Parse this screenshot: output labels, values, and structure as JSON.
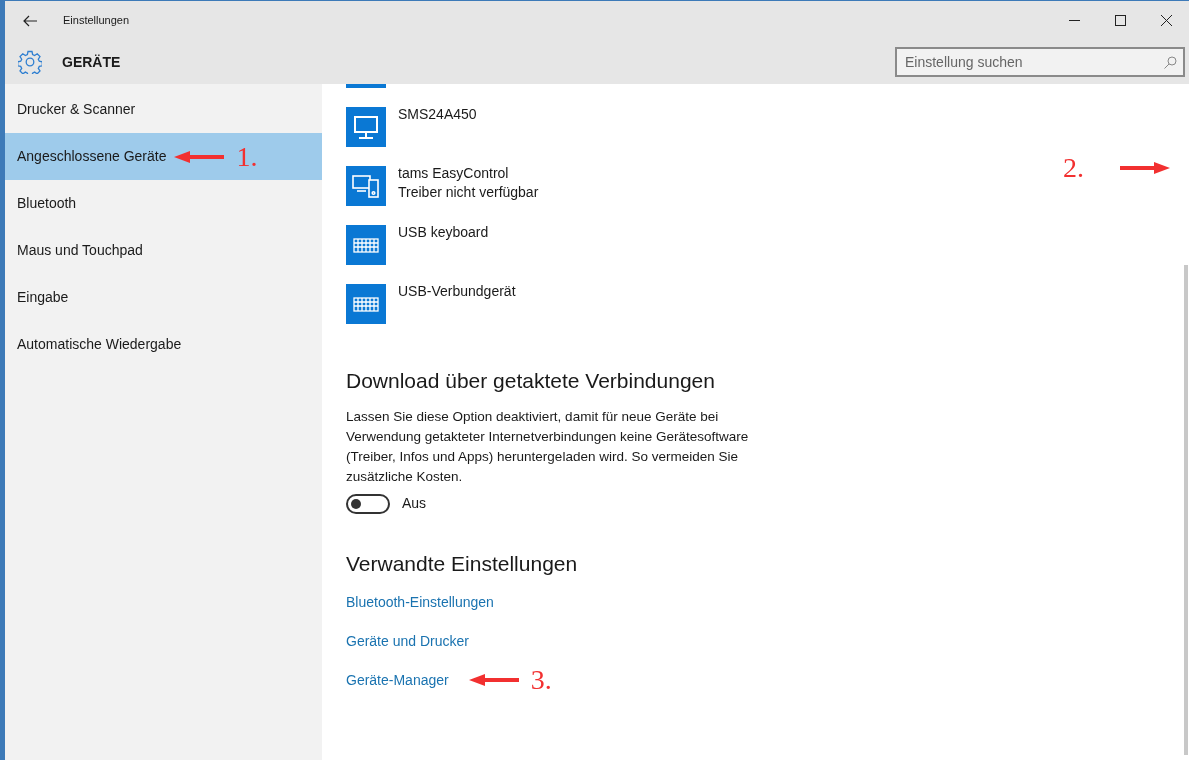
{
  "window": {
    "title": "Einstellungen"
  },
  "header": {
    "title": "GERÄTE",
    "search": {
      "placeholder": "Einstellung suchen"
    }
  },
  "sidebar": {
    "items": [
      {
        "label": "Drucker & Scanner",
        "selected": false
      },
      {
        "label": "Angeschlossene Geräte",
        "selected": true,
        "annotation": {
          "label": "1."
        }
      },
      {
        "label": "Bluetooth",
        "selected": false
      },
      {
        "label": "Maus und Touchpad",
        "selected": false
      },
      {
        "label": "Eingabe",
        "selected": false
      },
      {
        "label": "Automatische Wiedergabe",
        "selected": false
      }
    ]
  },
  "content": {
    "annotation": {
      "label": "2."
    },
    "devices": [
      {
        "kind": "partial"
      },
      {
        "kind": "monitor",
        "name": "SMS24A450"
      },
      {
        "kind": "combo",
        "name": "tams EasyControl",
        "status": "Treiber nicht verfügbar"
      },
      {
        "kind": "keyboard",
        "name": "USB keyboard"
      },
      {
        "kind": "keyboard",
        "name": "USB-Verbundgerät"
      }
    ],
    "metered": {
      "heading": "Download über getaktete Verbindungen",
      "description": "Lassen Sie diese Option deaktiviert, damit für neue Geräte bei Verwendung getakteter Internetverbindungen keine Gerätesoftware (Treiber, Infos und Apps) heruntergeladen wird. So vermeiden Sie zusätzliche Kosten.",
      "toggle": {
        "on": false,
        "label": "Aus"
      }
    },
    "related": {
      "heading": "Verwandte Einstellungen",
      "links": [
        {
          "label": "Bluetooth-Einstellungen"
        },
        {
          "label": "Geräte und Drucker"
        },
        {
          "label": "Geräte-Manager",
          "annotation": {
            "label": "3."
          }
        }
      ]
    }
  }
}
